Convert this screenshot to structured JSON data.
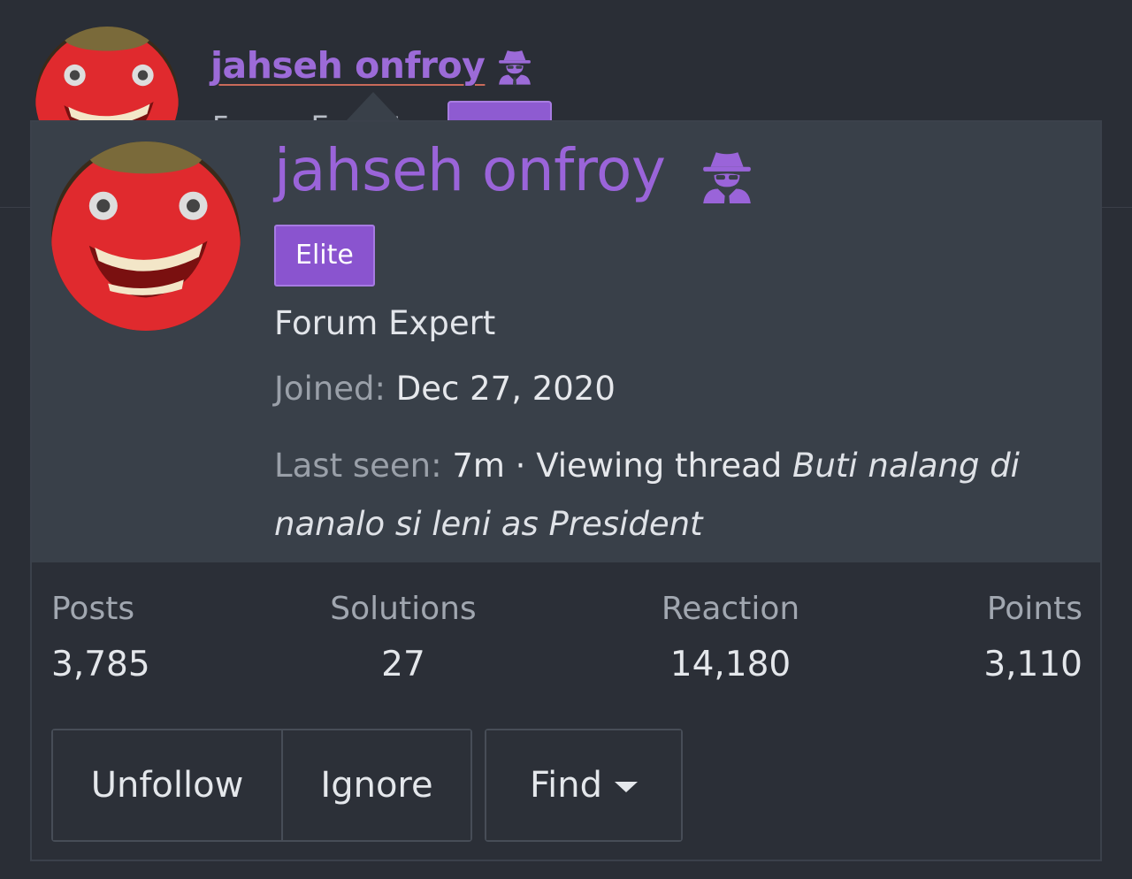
{
  "post_header": {
    "username": "jahseh onfroy",
    "title": "Forum Expert"
  },
  "popup": {
    "username": "jahseh onfroy",
    "badge": "Elite",
    "user_title": "Forum Expert",
    "joined_label": "Joined:",
    "joined_value": "Dec 27, 2020",
    "last_seen_label": "Last seen:",
    "last_seen_value": "7m · Viewing thread",
    "thread_title": "Buti nalang di nanalo si leni as President",
    "stats": [
      {
        "label": "Posts",
        "value": "3,785"
      },
      {
        "label": "Solutions",
        "value": "27"
      },
      {
        "label": "Reaction",
        "value": "14,180"
      },
      {
        "label": "Points",
        "value": "3,110"
      }
    ],
    "buttons": {
      "unfollow": "Unfollow",
      "ignore": "Ignore",
      "find": "Find"
    }
  },
  "icons": {
    "user_icon": "spy-icon",
    "find_caret": "caret-down-icon"
  },
  "colors": {
    "accent": "#9a64d9",
    "badge": "#8a54cf",
    "card_top": "#394049",
    "card_bottom": "#2b2f37",
    "page_bg": "#2a2e36"
  }
}
